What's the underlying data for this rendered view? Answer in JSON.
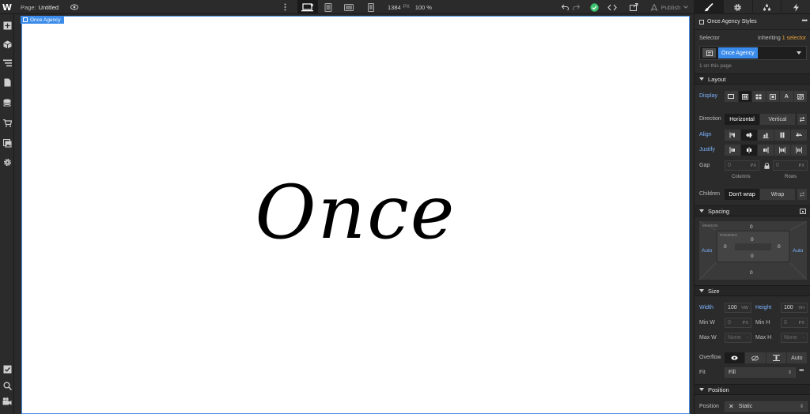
{
  "topbar": {
    "page_prefix": "Page:",
    "page_name": "Untitled",
    "width_value": "1384",
    "width_unit": "PX",
    "zoom": "100 %",
    "publish_label": "Publish"
  },
  "canvas": {
    "selected_tag": "Once Agency",
    "hero_text": "Once"
  },
  "panel": {
    "style_title": "Once Agency Styles",
    "selector_label": "Selector",
    "inheriting_text": "Inheriting",
    "inheriting_count": "1",
    "inheriting_link": "selector",
    "selector_chip": "Once Agency",
    "on_page": "1 on this page",
    "layout": {
      "title": "Layout",
      "display_label": "Display",
      "direction_label": "Direction",
      "direction_options": [
        "Horizontal",
        "Vertical"
      ],
      "align_label": "Align",
      "justify_label": "Justify",
      "gap_label": "Gap",
      "gap_columns": "0",
      "gap_rows": "0",
      "gap_unit": "PX",
      "columns_label": "Columns",
      "rows_label": "Rows",
      "children_label": "Children",
      "children_options": [
        "Don't wrap",
        "Wrap"
      ]
    },
    "spacing": {
      "title": "Spacing",
      "margin_label": "MARGIN",
      "padding_label": "PADDING",
      "margin_top": "0",
      "margin_bottom": "0",
      "margin_left": "Auto",
      "margin_right": "Auto",
      "padding_top": "0",
      "padding_bottom": "0",
      "padding_left": "0",
      "padding_right": "0"
    },
    "size": {
      "title": "Size",
      "width_label": "Width",
      "width_value": "100",
      "width_unit": "VW",
      "height_label": "Height",
      "height_value": "100",
      "height_unit": "VH",
      "minw_label": "Min W",
      "minw_value": "0",
      "minh_label": "Min H",
      "minh_value": "0",
      "min_unit": "PX",
      "maxw_label": "Max W",
      "maxh_label": "Max H",
      "max_value": "None",
      "max_unit": "-",
      "overflow_label": "Overflow",
      "overflow_auto": "Auto",
      "fit_label": "Fit",
      "fit_value": "Fill"
    },
    "position": {
      "title": "Position",
      "position_label": "Position",
      "position_value": "Static"
    }
  },
  "colors": {
    "accent": "#3b8beb",
    "panel_bg": "#2b2b2b",
    "blue_label": "#7cb4ff",
    "inherit_orange": "#e8a13a",
    "check_green": "#3cc36e"
  }
}
